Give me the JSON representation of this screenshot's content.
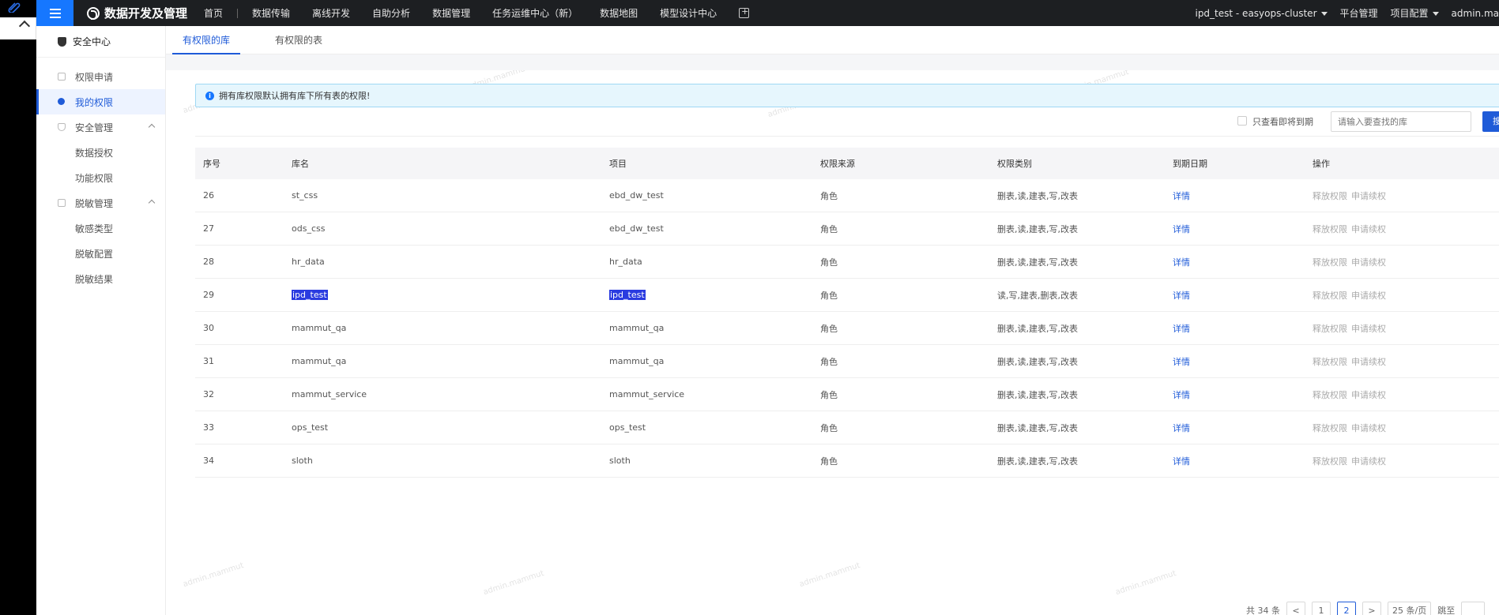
{
  "nav": {
    "brand": "数据开发及管理",
    "items": [
      "首页",
      "数据传输",
      "离线开发",
      "自助分析",
      "数据管理",
      "任务运维中心（新）",
      "数据地图",
      "模型设计中心"
    ],
    "cluster": "ipd_test - easyops-cluster",
    "platform": "平台管理",
    "project_config": "项目配置",
    "user": "admin.ma"
  },
  "sidebar": {
    "title": "安全中心",
    "items": [
      {
        "label": "权限申请"
      },
      {
        "label": "我的权限"
      },
      {
        "label": "安全管理"
      },
      {
        "label": "数据授权"
      },
      {
        "label": "功能权限"
      },
      {
        "label": "脱敏管理"
      },
      {
        "label": "敏感类型"
      },
      {
        "label": "脱敏配置"
      },
      {
        "label": "脱敏结果"
      }
    ]
  },
  "tabs": [
    "有权限的库",
    "有权限的表"
  ],
  "notice": "拥有库权限默认拥有库下所有表的权限!",
  "filter": {
    "checkbox_label": "只查看即将到期",
    "search_placeholder": "请输入要查找的库",
    "search_button": "搜"
  },
  "table": {
    "headers": [
      "序号",
      "库名",
      "项目",
      "权限来源",
      "权限类别",
      "到期日期",
      "操作"
    ],
    "rows": [
      {
        "no": "26",
        "db": "st_css",
        "project": "ebd_dw_test",
        "source": "角色",
        "perm": "删表,读,建表,写,改表",
        "expire": "详情",
        "op1": "释放权限",
        "op2": "申请续权"
      },
      {
        "no": "27",
        "db": "ods_css",
        "project": "ebd_dw_test",
        "source": "角色",
        "perm": "删表,读,建表,写,改表",
        "expire": "详情",
        "op1": "释放权限",
        "op2": "申请续权"
      },
      {
        "no": "28",
        "db": "hr_data",
        "project": "hr_data",
        "source": "角色",
        "perm": "删表,读,建表,写,改表",
        "expire": "详情",
        "op1": "释放权限",
        "op2": "申请续权"
      },
      {
        "no": "29",
        "db": "ipd_test",
        "project": "ipd_test",
        "source": "角色",
        "perm": "读,写,建表,删表,改表",
        "expire": "详情",
        "op1": "释放权限",
        "op2": "申请续权"
      },
      {
        "no": "30",
        "db": "mammut_qa",
        "project": "mammut_qa",
        "source": "角色",
        "perm": "删表,读,建表,写,改表",
        "expire": "详情",
        "op1": "释放权限",
        "op2": "申请续权"
      },
      {
        "no": "31",
        "db": "mammut_qa",
        "project": "mammut_qa",
        "source": "角色",
        "perm": "删表,读,建表,写,改表",
        "expire": "详情",
        "op1": "释放权限",
        "op2": "申请续权"
      },
      {
        "no": "32",
        "db": "mammut_service",
        "project": "mammut_service",
        "source": "角色",
        "perm": "删表,读,建表,写,改表",
        "expire": "详情",
        "op1": "释放权限",
        "op2": "申请续权"
      },
      {
        "no": "33",
        "db": "ops_test",
        "project": "ops_test",
        "source": "角色",
        "perm": "删表,读,建表,写,改表",
        "expire": "详情",
        "op1": "释放权限",
        "op2": "申请续权"
      },
      {
        "no": "34",
        "db": "sloth",
        "project": "sloth",
        "source": "角色",
        "perm": "删表,读,建表,写,改表",
        "expire": "详情",
        "op1": "释放权限",
        "op2": "申请续权"
      }
    ]
  },
  "pagination": {
    "total": "共 34 条",
    "prev": "<",
    "pages": [
      "1",
      "2"
    ],
    "current": "2",
    "next": ">",
    "page_size": "25 条/页",
    "jump": "跳至"
  },
  "colors": {
    "accent": "#1f5bd8",
    "topbar": "#1d1f22",
    "menu_button": "#1677ff"
  }
}
